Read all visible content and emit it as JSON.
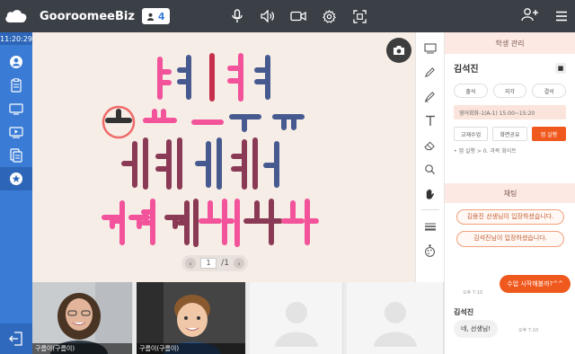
{
  "header": {
    "brand": "GooroomeeBiz",
    "participant_count": "4"
  },
  "sidebar": {
    "time": "11:20:29"
  },
  "board": {
    "page_current": "1",
    "page_total": "/1"
  },
  "videos": {
    "tile1_label": "구름이(구름이)",
    "tile2_label": "구름이(구름이)"
  },
  "panel": {
    "student_mgmt_title": "학생 관리",
    "student_name": "김석진",
    "attendance": [
      "출석",
      "지각",
      "결석"
    ],
    "schedule_text": "영어회화-1(A-1) 15:00~15:20",
    "actions": [
      "교재수업",
      "화면공유",
      "앱 실행"
    ],
    "note": "• 앱 실행 > 0. 과목 화이트",
    "chat_title": "채팅",
    "system_msg_1": "김용진 선생님이 입장하셨습니다.",
    "system_msg_2": "김석진님이 입장하셨습니다.",
    "my_message": "수업 시작해볼까?^^",
    "my_time": "오후 7:10",
    "sender_name": "김석진",
    "reply_message": "네, 선생님!",
    "reply_time": "오후 7:10"
  },
  "colors": {
    "accent_orange": "#f0591e",
    "sidebar_blue": "#3a7bd5",
    "topbar": "#3b3f46"
  },
  "icons": [
    "cloud-logo-icon",
    "person-icon",
    "mic-icon",
    "speaker-icon",
    "camera-icon",
    "settings-icon",
    "fullscreen-icon",
    "add-user-icon",
    "menu-icon",
    "clipboard-icon",
    "monitor-icon",
    "play-icon",
    "document-icon",
    "star-icon",
    "exit-icon",
    "pen-icon",
    "text-icon",
    "eraser-icon",
    "search-icon",
    "hand-icon",
    "lines-icon",
    "palette-icon"
  ]
}
